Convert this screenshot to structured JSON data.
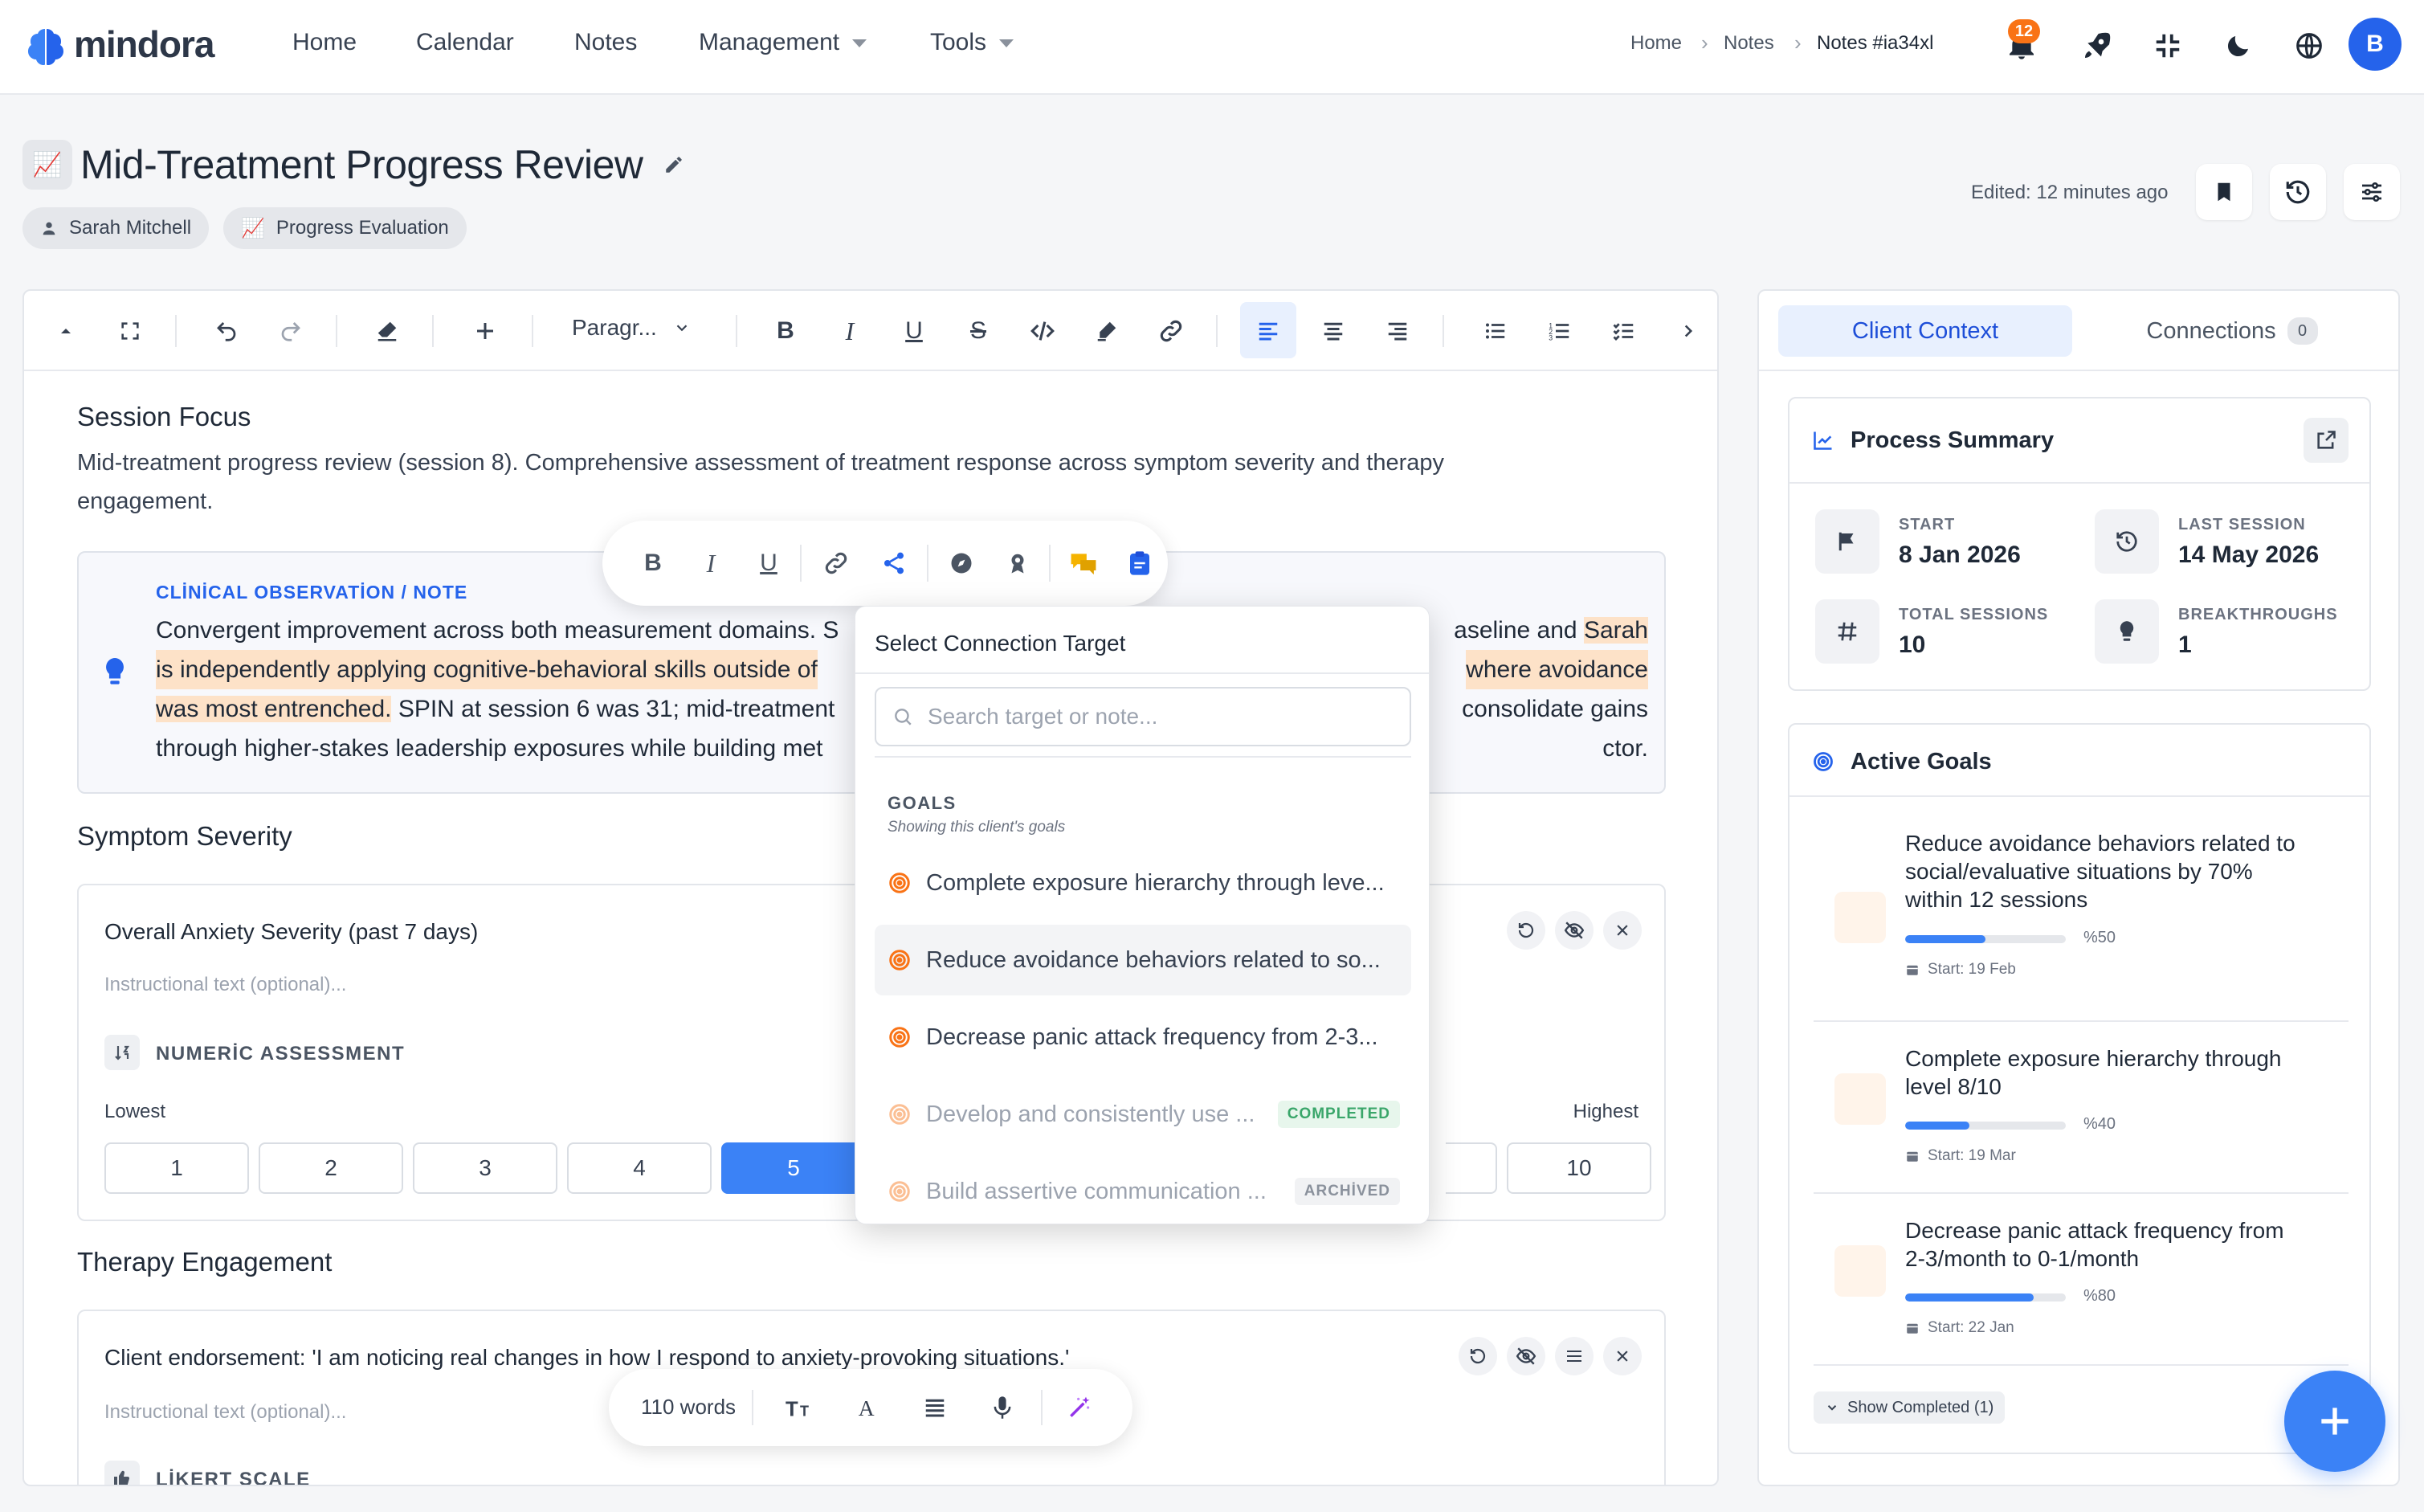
{
  "app": {
    "brand": "mindora"
  },
  "nav": {
    "items": [
      "Home",
      "Calendar",
      "Notes",
      "Management",
      "Tools"
    ]
  },
  "breadcrumb": [
    "Home",
    "Notes",
    "Notes #ia34xl"
  ],
  "notifications": {
    "count": "12"
  },
  "user": {
    "initial": "B"
  },
  "page": {
    "title": "Mid-Treatment Progress Review",
    "chips": [
      "Sarah Mitchell",
      "Progress Evaluation"
    ],
    "edited": "Edited: 12 minutes ago"
  },
  "toolbar": {
    "paragraph": "Paragr..."
  },
  "editor": {
    "session_focus_heading": "Session Focus",
    "session_focus_text_1": "Mid-treatment progress review (session 8). Comprehensive assessment of treatment response across symptom severity and therapy",
    "session_focus_text_2": "engagement.",
    "obs_label": "CLİNİCAL OBSERVATİON / NOTE",
    "obs_line1_a": "Convergent improvement across both measurement domains. S",
    "obs_line1_b": "aseline and ",
    "obs_line1_hl": "Sarah",
    "obs_line2_hl_a": "is independently applying cognitive-behavioral skills outside of",
    "obs_line2_hl_b": " where avoidance",
    "obs_line3_hl": "was most entrenched.",
    "obs_line3_a": " SPIN at session 6 was 31; mid-treatment",
    "obs_line3_b": " consolidate gains",
    "obs_line4_a": "through higher-stakes leadership exposures while building met",
    "obs_line4_b": "ctor.",
    "symptom_heading": "Symptom Severity",
    "symptom_card_title": "Overall Anxiety Severity (past 7 days)",
    "instructional_placeholder": "Instructional text (optional)...",
    "numeric_label": "NUMERİC ASSESSMENT",
    "scale_low": "Lowest",
    "scale_high": "Highest",
    "scale_values": [
      "1",
      "2",
      "3",
      "4",
      "5",
      "10"
    ],
    "scale_selected": "5",
    "engagement_heading": "Therapy Engagement",
    "engagement_card_title": "Client endorsement: 'I am noticing real changes in how I respond to anxiety-provoking situations.'",
    "likert_label": "LİKERT SCALE"
  },
  "connection_popover": {
    "title": "Select Connection Target",
    "search_placeholder": "Search target or note...",
    "group": "GOALS",
    "group_sub": "Showing this client's goals",
    "goals": [
      {
        "text": "Complete exposure hierarchy through leve...",
        "status": ""
      },
      {
        "text": "Reduce avoidance behaviors related to so...",
        "status": ""
      },
      {
        "text": "Decrease panic attack frequency from 2-3...",
        "status": ""
      },
      {
        "text": "Develop and consistently use ...",
        "status": "COMPLETED"
      },
      {
        "text": "Build assertive communication ...",
        "status": "ARCHİVED"
      }
    ]
  },
  "wordbar": {
    "count": "110 words"
  },
  "sidepanel": {
    "tabs": [
      {
        "label": "Client Context"
      },
      {
        "label": "Connections",
        "count": "0"
      }
    ],
    "process_title": "Process Summary",
    "stats": [
      {
        "label": "START",
        "value": "8 Jan 2026"
      },
      {
        "label": "LAST SESSION",
        "value": "14 May 2026"
      },
      {
        "label": "TOTAL SESSIONS",
        "value": "10"
      },
      {
        "label": "BREAKTHROUGHS",
        "value": "1"
      }
    ],
    "goals_title": "Active Goals",
    "goals": [
      {
        "lines": [
          "Reduce avoidance behaviors related to",
          "social/evaluative situations by 70%",
          "within 12 sessions"
        ],
        "progress": 50,
        "pct": "%50",
        "start": "Start: 19 Feb"
      },
      {
        "lines": [
          "Complete exposure hierarchy through",
          "level 8/10"
        ],
        "progress": 40,
        "pct": "%40",
        "start": "Start: 19 Mar"
      },
      {
        "lines": [
          "Decrease panic attack frequency from",
          "2-3/month to 0-1/month"
        ],
        "progress": 80,
        "pct": "%80",
        "start": "Start: 22 Jan"
      }
    ],
    "show_completed": "Show Completed (1)"
  },
  "colors": {
    "accent": "#3b82f6",
    "highlight": "#fde2c8",
    "goal_icon": "#f97316"
  }
}
